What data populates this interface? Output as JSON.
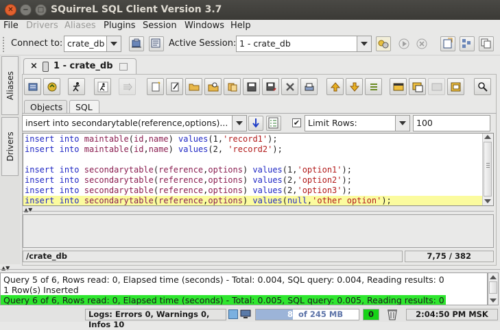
{
  "window": {
    "title": "SQuirreL SQL Client Version 3.7"
  },
  "menu": [
    {
      "label": "File",
      "enabled": true
    },
    {
      "label": "Drivers",
      "enabled": false
    },
    {
      "label": "Aliases",
      "enabled": false
    },
    {
      "label": "Plugins",
      "enabled": true
    },
    {
      "label": "Session",
      "enabled": true
    },
    {
      "label": "Windows",
      "enabled": true
    },
    {
      "label": "Help",
      "enabled": true
    }
  ],
  "toolbar": {
    "connect_label": "Connect to:",
    "connect_value": "crate_db",
    "active_session_label": "Active Session:",
    "active_session_value": "1 - crate_db"
  },
  "sidebar": {
    "aliases": "Aliases",
    "drivers": "Drivers"
  },
  "session_tab": {
    "close": "×",
    "label": "1 - crate_db"
  },
  "subtabs": {
    "objects": "Objects",
    "sql": "SQL"
  },
  "sql_history": {
    "value": "insert into secondarytable(reference,options)..."
  },
  "limit": {
    "checked": true,
    "label": "Limit Rows:",
    "value": "100"
  },
  "editor": {
    "lines": [
      [
        [
          "kw",
          "insert"
        ],
        [
          "t",
          " "
        ],
        [
          "kw",
          "into"
        ],
        [
          "t",
          " "
        ],
        [
          "id",
          "maintable"
        ],
        [
          "t",
          "("
        ],
        [
          "id",
          "id"
        ],
        [
          "t",
          ","
        ],
        [
          "id",
          "name"
        ],
        [
          "t",
          ") "
        ],
        [
          "kw",
          "values"
        ],
        [
          "t",
          "("
        ],
        [
          "num",
          "1"
        ],
        [
          "t",
          ","
        ],
        [
          "str",
          "'record1'"
        ],
        [
          "t",
          ");"
        ]
      ],
      [
        [
          "kw",
          "insert"
        ],
        [
          "t",
          " "
        ],
        [
          "kw",
          "into"
        ],
        [
          "t",
          " "
        ],
        [
          "id",
          "maintable"
        ],
        [
          "t",
          "("
        ],
        [
          "id",
          "id"
        ],
        [
          "t",
          ","
        ],
        [
          "id",
          "name"
        ],
        [
          "t",
          ") "
        ],
        [
          "kw",
          "values"
        ],
        [
          "t",
          "("
        ],
        [
          "num",
          "2"
        ],
        [
          "t",
          ", "
        ],
        [
          "str",
          "'record2'"
        ],
        [
          "t",
          ");"
        ]
      ],
      [],
      [
        [
          "kw",
          "insert"
        ],
        [
          "t",
          " "
        ],
        [
          "kw",
          "into"
        ],
        [
          "t",
          " "
        ],
        [
          "id",
          "secondarytable"
        ],
        [
          "t",
          "("
        ],
        [
          "id",
          "reference"
        ],
        [
          "t",
          ","
        ],
        [
          "id",
          "options"
        ],
        [
          "t",
          ") "
        ],
        [
          "kw",
          "values"
        ],
        [
          "t",
          "("
        ],
        [
          "num",
          "1"
        ],
        [
          "t",
          ","
        ],
        [
          "str",
          "'option1'"
        ],
        [
          "t",
          ");"
        ]
      ],
      [
        [
          "kw",
          "insert"
        ],
        [
          "t",
          " "
        ],
        [
          "kw",
          "into"
        ],
        [
          "t",
          " "
        ],
        [
          "id",
          "secondarytable"
        ],
        [
          "t",
          "("
        ],
        [
          "id",
          "reference"
        ],
        [
          "t",
          ","
        ],
        [
          "id",
          "options"
        ],
        [
          "t",
          ") "
        ],
        [
          "kw",
          "values"
        ],
        [
          "t",
          "("
        ],
        [
          "num",
          "2"
        ],
        [
          "t",
          ","
        ],
        [
          "str",
          "'option2'"
        ],
        [
          "t",
          ");"
        ]
      ],
      [
        [
          "kw",
          "insert"
        ],
        [
          "t",
          " "
        ],
        [
          "kw",
          "into"
        ],
        [
          "t",
          " "
        ],
        [
          "id",
          "secondarytable"
        ],
        [
          "t",
          "("
        ],
        [
          "id",
          "reference"
        ],
        [
          "t",
          ","
        ],
        [
          "id",
          "options"
        ],
        [
          "t",
          ") "
        ],
        [
          "kw",
          "values"
        ],
        [
          "t",
          "("
        ],
        [
          "num",
          "2"
        ],
        [
          "t",
          ","
        ],
        [
          "str",
          "'option3'"
        ],
        [
          "t",
          ");"
        ]
      ],
      [
        [
          "kw",
          "insert"
        ],
        [
          "t",
          " "
        ],
        [
          "kw",
          "into"
        ],
        [
          "t",
          " "
        ],
        [
          "id",
          "secondarytable"
        ],
        [
          "t",
          "("
        ],
        [
          "id",
          "reference"
        ],
        [
          "t",
          ","
        ],
        [
          "id",
          "options"
        ],
        [
          "t",
          ") "
        ],
        [
          "kw",
          "values"
        ],
        [
          "t",
          "("
        ],
        [
          "kw",
          "null"
        ],
        [
          "t",
          ","
        ],
        [
          "str",
          "'other option'"
        ],
        [
          "t",
          ");"
        ]
      ]
    ],
    "highlight_line": 6,
    "highlight_color": "#fbfb9e"
  },
  "editor_status": {
    "path": "/crate_db",
    "position": "7,75 / 382"
  },
  "output": {
    "lines": [
      "Query 5 of 6, Rows read: 0, Elapsed time (seconds) - Total: 0.004, SQL query: 0.004, Reading results: 0",
      "1 Row(s) Inserted",
      "Query 6 of 6, Rows read: 0, Elapsed time (seconds) - Total: 0.005, SQL query: 0.005, Reading results: 0"
    ],
    "highlight_color": "#2ee62e"
  },
  "status": {
    "logs": "Logs: Errors 0, Warnings 0, Infos 10",
    "memory_used": "88",
    "memory_total": "of 245 MB",
    "memory_fraction": 0.36,
    "counter": "0",
    "time": "2:04:50 PM MSK"
  },
  "colors": {
    "title_bg": "#3c3b37",
    "accent": "#2ee62e",
    "close_btn": "#e2612e"
  }
}
